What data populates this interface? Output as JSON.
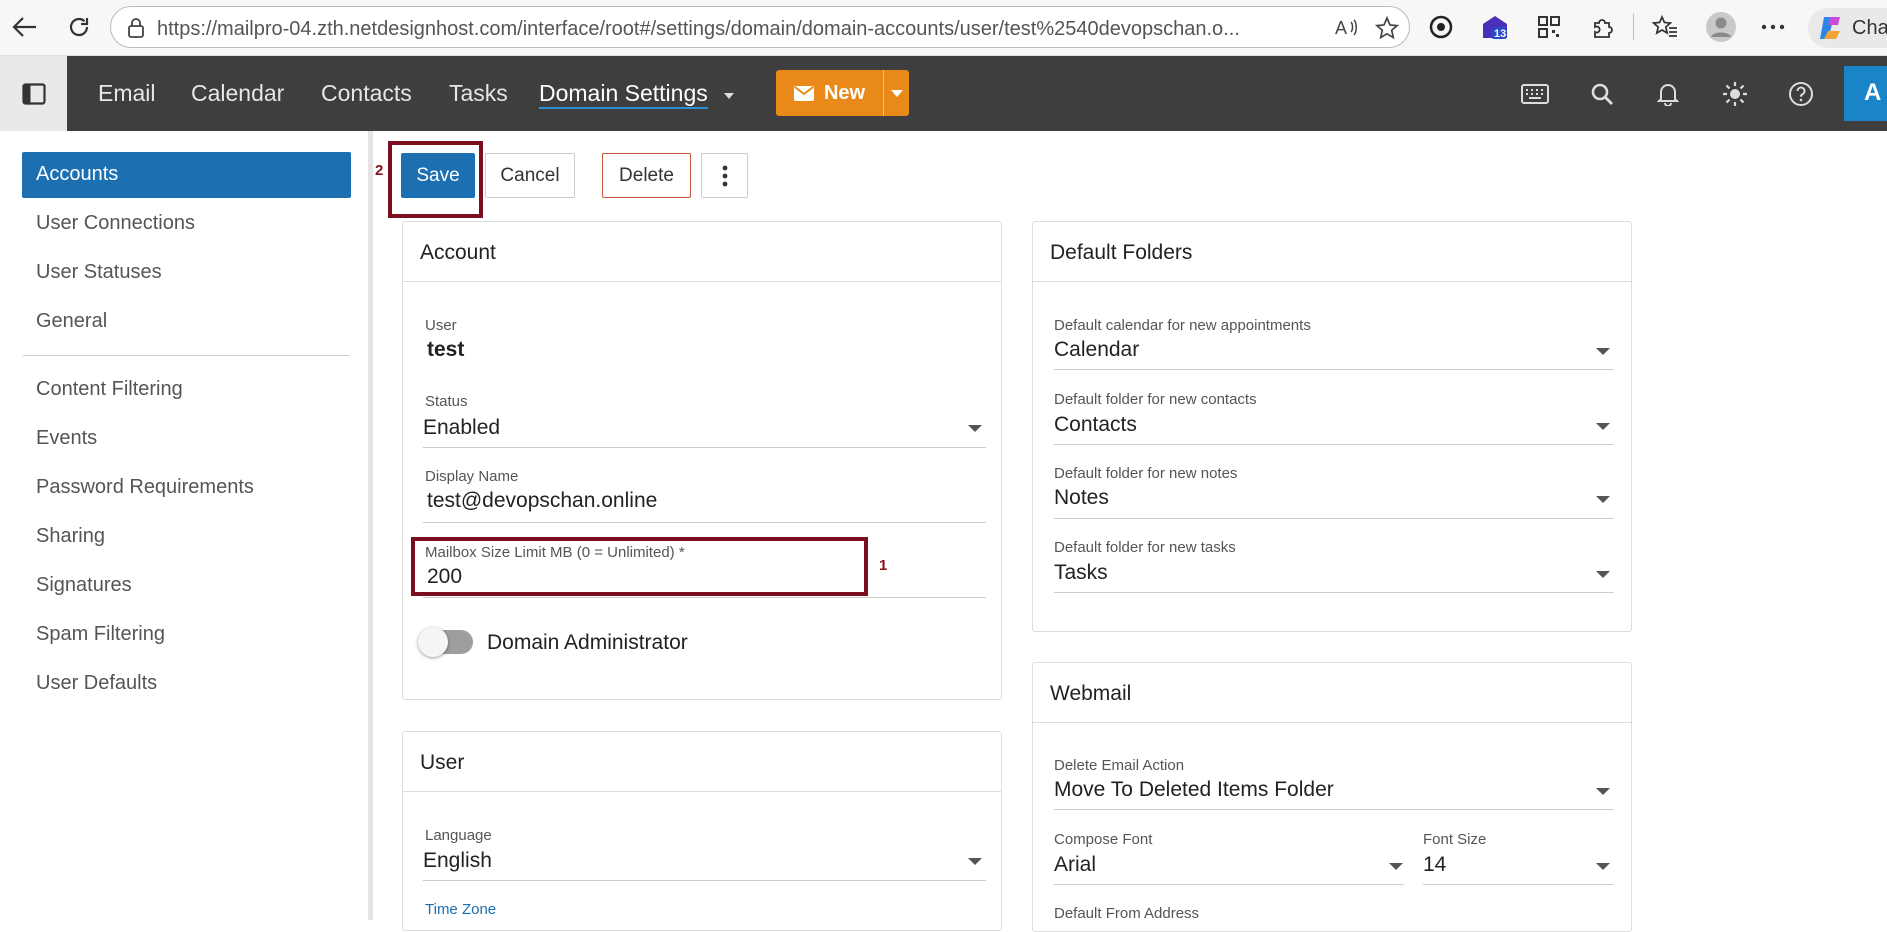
{
  "browser": {
    "url": "https://mailpro-04.zth.netdesignhost.com/interface/root#/settings/domain/domain-accounts/user/test%2540devopschan.o...",
    "badge_count": "13",
    "copilot_label": "Cha"
  },
  "topnav": {
    "items": [
      "Email",
      "Calendar",
      "Contacts",
      "Tasks"
    ],
    "active": "Domain Settings",
    "new_label": "New",
    "avatar_letter": "A"
  },
  "sidebar": {
    "group1": [
      "Accounts",
      "User Connections",
      "User Statuses",
      "General"
    ],
    "group2": [
      "Content Filtering",
      "Events",
      "Password Requirements",
      "Sharing",
      "Signatures",
      "Spam Filtering",
      "User Defaults"
    ]
  },
  "toolbar": {
    "save": "Save",
    "cancel": "Cancel",
    "delete": "Delete"
  },
  "annotations": {
    "save_marker": "2",
    "mailbox_marker": "1"
  },
  "account": {
    "title": "Account",
    "user_label": "User",
    "user_value": "test",
    "status_label": "Status",
    "status_value": "Enabled",
    "display_name_label": "Display Name",
    "display_name_value": "test@devopschan.online",
    "mailbox_label": "Mailbox Size Limit MB (0 = Unlimited) *",
    "mailbox_value": "200",
    "domain_admin_label": "Domain Administrator",
    "domain_admin_on": false
  },
  "user": {
    "title": "User",
    "language_label": "Language",
    "language_value": "English",
    "timezone_label": "Time Zone"
  },
  "default_folders": {
    "title": "Default Folders",
    "calendar_label": "Default calendar for new appointments",
    "calendar_value": "Calendar",
    "contacts_label": "Default folder for new contacts",
    "contacts_value": "Contacts",
    "notes_label": "Default folder for new notes",
    "notes_value": "Notes",
    "tasks_label": "Default folder for new tasks",
    "tasks_value": "Tasks"
  },
  "webmail": {
    "title": "Webmail",
    "delete_action_label": "Delete Email Action",
    "delete_action_value": "Move To Deleted Items Folder",
    "compose_font_label": "Compose Font",
    "compose_font_value": "Arial",
    "font_size_label": "Font Size",
    "font_size_value": "14",
    "from_address_label": "Default From Address"
  },
  "colors": {
    "accent": "#1c6fb0",
    "new_button": "#e8891a",
    "highlight": "#7b0f1f"
  }
}
